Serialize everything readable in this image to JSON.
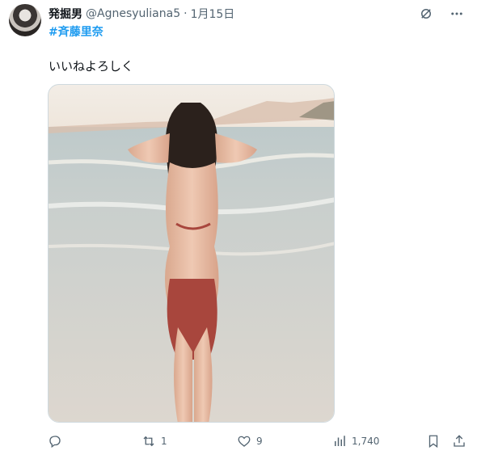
{
  "author": {
    "display_name": "発掘男",
    "handle": "@Agnesyuliana5",
    "separator": "·",
    "timestamp": "1月15日"
  },
  "tweet": {
    "hashtag": "#斉藤里奈",
    "text": "いいねよろしく"
  },
  "actions": {
    "reply_count": "",
    "retweet_count": "1",
    "like_count": "9",
    "views_count": "1,740"
  },
  "icons": {
    "grok": "grok-icon",
    "more": "more-icon",
    "reply": "reply-icon",
    "retweet": "retweet-icon",
    "like": "heart-icon",
    "views": "views-icon",
    "bookmark": "bookmark-icon",
    "share": "share-icon"
  },
  "colors": {
    "accent": "#1d9bf0",
    "text": "#0f1419",
    "muted": "#536471"
  }
}
